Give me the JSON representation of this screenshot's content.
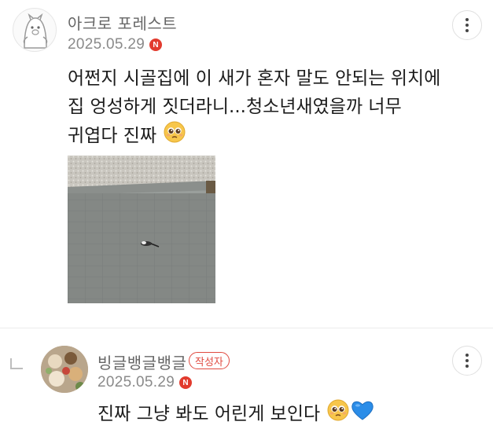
{
  "comments": [
    {
      "author": "아크로 포레스트",
      "date": "2025.05.29",
      "n_badge": "N",
      "lines": [
        "어쩐지 시골집에 이 새가 혼자 말도 안되는 위치에",
        "집 엉성하게 짓더라니...청소년새였을까 너무",
        "귀엽다 진짜"
      ],
      "emoji": "pleading-face"
    },
    {
      "author": "빙글뱅글뱅글",
      "author_badge": "작성자",
      "date": "2025.05.29",
      "n_badge": "N",
      "text": "진짜 그냥 봐도 어린게 보인다",
      "emojis": [
        "pleading-face",
        "blue-heart"
      ]
    }
  ],
  "colors": {
    "accent_red": "#e23b2e",
    "badge_red": "#e04a40",
    "meta_gray": "#8a8a8a"
  }
}
